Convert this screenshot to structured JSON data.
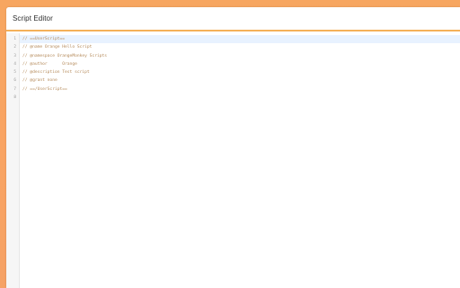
{
  "window": {
    "title": "Script Editor"
  },
  "editor": {
    "line_numbers": [
      "1",
      "2",
      "3",
      "4",
      "5",
      "6",
      "7",
      "8"
    ],
    "lines": [
      "// ==UserScript==",
      "// @name Orange Hello Script",
      "// @namespace OrangeMonkey Scripts",
      "// @author      Orange",
      "// @description Test script",
      "// @grant none",
      "// ==/UserScript==",
      ""
    ],
    "active_line": 1
  },
  "colors": {
    "background_gradient": "#f7a660",
    "title_underline": "#f4b15a",
    "comment_text": "#b58a5a",
    "active_line_bg": "#e8f2ff"
  }
}
